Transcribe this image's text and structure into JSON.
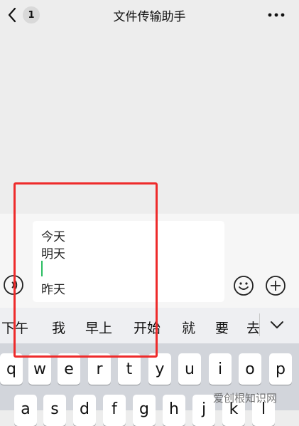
{
  "header": {
    "back_icon": "chevron-left-icon",
    "unread_badge": "1",
    "title": "文件传输助手",
    "more_icon": "ellipsis-icon"
  },
  "input": {
    "lines": [
      "今天",
      "明天",
      "",
      "昨天"
    ],
    "voice_icon": "voice-icon",
    "emoji_icon": "emoji-icon",
    "plus_icon": "plus-circle-icon",
    "caret_color": "#2bbd61"
  },
  "annotation_color": "#ee2b2b",
  "keyboard": {
    "candidates": [
      "下午",
      "我",
      "早上",
      "开始",
      "就",
      "要",
      "去"
    ],
    "collapse_icon": "chevron-down-icon",
    "row1": [
      "q",
      "w",
      "e",
      "r",
      "t",
      "y",
      "u",
      "i",
      "o",
      "p"
    ],
    "row2": [
      "a",
      "s",
      "d",
      "f",
      "g",
      "h",
      "j",
      "k",
      "l"
    ]
  },
  "watermark": "爱创根知识网"
}
